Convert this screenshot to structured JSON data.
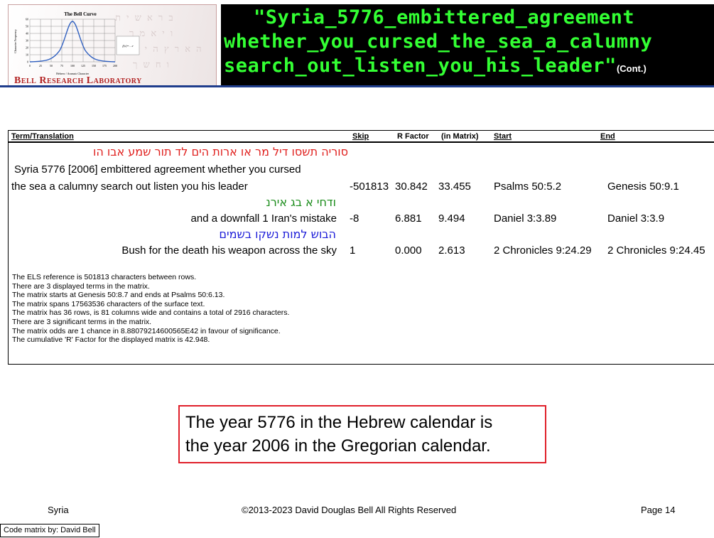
{
  "logo": {
    "chart_title": "The Bell Curve",
    "y_axis_label": "Character Frequency",
    "x_axis_label": "Hebrew / Aramaic Character",
    "y_ticks": [
      "60",
      "50",
      "40",
      "30",
      "20",
      "10",
      "0"
    ],
    "x_ticks": [
      "0",
      "25",
      "50",
      "75",
      "100",
      "125",
      "150",
      "175",
      "200"
    ],
    "lab_name": "Bell Research Laboratory"
  },
  "title": {
    "line1": "\"Syria_5776_embittered_agreement",
    "line2": "whether_you_cursed_the_sea_a_calumny",
    "line3": "search_out_listen_you_his_leader\"",
    "cont": "(Cont.)"
  },
  "table": {
    "headers": {
      "term": "Term/Translation",
      "skip": "Skip",
      "rfactor": "R Factor",
      "in_matrix": "(in Matrix)",
      "start": "Start",
      "end": "End"
    },
    "rows": [
      {
        "hebrew": "סוריה תשסו דיל מר או ארות הים לד תור שמע אבו הו",
        "translation_1": "Syria 5776 [2006] embittered agreement whether you cursed",
        "translation_2": "the sea a calumny search out listen you his leader",
        "skip": "-501813",
        "rfactor": "30.842",
        "in_matrix": "33.455",
        "start": "Psalms 50:5.2",
        "end": "Genesis 50:9.1",
        "color": "#e0201e"
      },
      {
        "hebrew": "ודחי א בג אירנ",
        "translation": "and a downfall 1 Iran's mistake",
        "skip": "-8",
        "rfactor": "6.881",
        "in_matrix": "9.494",
        "start": "Daniel 3:3.89",
        "end": "Daniel 3:3.9",
        "color": "#1a8c1a"
      },
      {
        "hebrew": "הבוש למות נשקו בשמים",
        "translation": "Bush for the death his weapon across the sky",
        "skip": "1",
        "rfactor": "0.000",
        "in_matrix": "2.613",
        "start": "2 Chronicles 9:24.29",
        "end": "2 Chronicles 9:24.45",
        "color": "#1c1cd8"
      }
    ]
  },
  "notes": [
    "The ELS reference is 501813 characters between rows.",
    "There are 3 displayed terms in the matrix.",
    "The matrix starts at Genesis 50:8.7 and ends at Psalms 50:6.13.",
    "The matrix spans 17563536 characters of the surface text.",
    "The matrix has 36 rows, is 81 columns wide and contains a total of 2916 characters.",
    "There are 3 significant terms in the matrix.",
    "The matrix odds are 1 chance in 8.88079214600565E42  in favour of significance.",
    "The cumulative 'R' Factor for the displayed matrix is 42.948."
  ],
  "callout": {
    "line1": "The year 5776 in the Hebrew calendar is",
    "line2": "the year 2006 in the Gregorian calendar."
  },
  "footer": {
    "left": "Syria",
    "center": "©2013-2023 David Douglas Bell All Rights Reserved",
    "right": "Page 14",
    "credit": "Code matrix by: David Bell"
  }
}
